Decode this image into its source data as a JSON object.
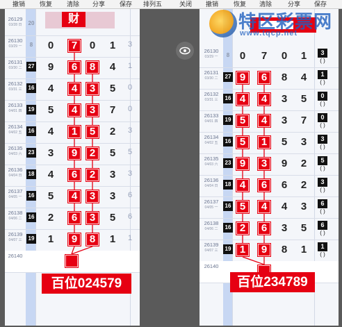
{
  "toolbar": {
    "undo": "撤销",
    "restore": "恢复",
    "clear": "清除",
    "share": "分享",
    "save": "保存",
    "p5": "排列五",
    "close": "关闭"
  },
  "left": {
    "rows": [
      {
        "issue": "26129",
        "date": "03/28 日",
        "sum": "20",
        "sumDark": false
      },
      {
        "issue": "26130",
        "date": "03/29 一",
        "sum": "8",
        "sumDark": false,
        "digits": [
          "0",
          "7",
          "0",
          "1"
        ],
        "hit": 1,
        "side": "3"
      },
      {
        "issue": "26131",
        "date": "03/30 二",
        "sum": "27",
        "sumDark": true,
        "digits": [
          "9",
          "6",
          "8",
          "4"
        ],
        "hit": 1,
        "hit2": 2,
        "side": "1"
      },
      {
        "issue": "26132",
        "date": "03/31 三",
        "sum": "16",
        "sumDark": true,
        "digits": [
          "4",
          "4",
          "3",
          "5"
        ],
        "hit": 1,
        "hit2": 2,
        "side": "0"
      },
      {
        "issue": "26133",
        "date": "04/01 四",
        "sum": "19",
        "sumDark": true,
        "digits": [
          "5",
          "4",
          "3",
          "7"
        ],
        "hit": 1,
        "hit2": 2,
        "side": "0"
      },
      {
        "issue": "26134",
        "date": "04/02 五",
        "sum": "16",
        "sumDark": true,
        "digits": [
          "4",
          "1",
          "5",
          "2"
        ],
        "hit": 1,
        "hit2": 2,
        "side": "3"
      },
      {
        "issue": "26135",
        "date": "04/03 六",
        "sum": "23",
        "sumDark": true,
        "digits": [
          "3",
          "9",
          "2",
          "5"
        ],
        "hit": 1,
        "hit2": 2,
        "side": "5"
      },
      {
        "issue": "26136",
        "date": "04/04 日",
        "sum": "18",
        "sumDark": true,
        "digits": [
          "4",
          "6",
          "2",
          "3"
        ],
        "hit": 1,
        "hit2": 2,
        "side": "3"
      },
      {
        "issue": "26137",
        "date": "04/05 一",
        "sum": "16",
        "sumDark": true,
        "digits": [
          "5",
          "4",
          "3",
          "3"
        ],
        "hit": 1,
        "hit2": 2,
        "side": "6"
      },
      {
        "issue": "26138",
        "date": "04/06 二",
        "sum": "16",
        "sumDark": true,
        "digits": [
          "2",
          "6",
          "3",
          "5"
        ],
        "hit": 1,
        "hit2": 2,
        "side": "6"
      },
      {
        "issue": "26139",
        "date": "04/07 三",
        "sum": "19",
        "sumDark": true,
        "digits": [
          "1",
          "9",
          "8",
          "1"
        ],
        "hit": 1,
        "hit2": 2,
        "side": "1"
      },
      {
        "issue": "26140",
        "date": "",
        "sum": "",
        "sumDark": false,
        "digits": [],
        "hitOnly": 1
      }
    ],
    "caption": "百位024579",
    "headerMask": "财"
  },
  "right": {
    "rows": [
      {
        "issue": "26130",
        "date": "03/29 一",
        "sum": "8",
        "sumDark": false,
        "digits": [
          "0",
          "7",
          "0",
          "1"
        ],
        "box": "3"
      },
      {
        "issue": "26131",
        "date": "03/30 二",
        "sum": "27",
        "sumDark": true,
        "digits": [
          "9",
          "6",
          "8",
          "4"
        ],
        "hit": 0,
        "hit2": 1,
        "box": "1"
      },
      {
        "issue": "26132",
        "date": "03/31 三",
        "sum": "16",
        "sumDark": true,
        "digits": [
          "4",
          "4",
          "3",
          "5"
        ],
        "hit": 0,
        "hit2": 1,
        "box": "0"
      },
      {
        "issue": "26133",
        "date": "04/01 四",
        "sum": "19",
        "sumDark": true,
        "digits": [
          "5",
          "4",
          "3",
          "7"
        ],
        "hit": 0,
        "hit2": 1,
        "box": "0"
      },
      {
        "issue": "26134",
        "date": "04/02 五",
        "sum": "16",
        "sumDark": true,
        "digits": [
          "5",
          "1",
          "5",
          "3"
        ],
        "hit": 0,
        "hit2": 1,
        "box": "3"
      },
      {
        "issue": "26135",
        "date": "04/03 六",
        "sum": "23",
        "sumDark": true,
        "digits": [
          "9",
          "3",
          "9",
          "2"
        ],
        "hit": 0,
        "hit2": 1,
        "box": "5"
      },
      {
        "issue": "26136",
        "date": "04/04 日",
        "sum": "18",
        "sumDark": true,
        "digits": [
          "4",
          "6",
          "6",
          "2"
        ],
        "hit": 0,
        "hit2": 1,
        "box": "3"
      },
      {
        "issue": "26137",
        "date": "04/05 一",
        "sum": "16",
        "sumDark": true,
        "digits": [
          "5",
          "4",
          "4",
          "3"
        ],
        "hit": 0,
        "hit2": 1,
        "box": "6"
      },
      {
        "issue": "26138",
        "date": "04/06 二",
        "sum": "16",
        "sumDark": true,
        "digits": [
          "2",
          "6",
          "3",
          "5"
        ],
        "hit": 0,
        "hit2": 1,
        "box": "6"
      },
      {
        "issue": "26139",
        "date": "04/07 三",
        "sum": "19",
        "sumDark": true,
        "digits": [
          "1",
          "9",
          "8",
          "1"
        ],
        "hit": 0,
        "hit2": 1,
        "box": "1"
      },
      {
        "issue": "26140",
        "date": "",
        "sum": "",
        "sumDark": false,
        "digits": [],
        "hitOnly": 1
      }
    ],
    "caption": "百位234789"
  },
  "watermark": {
    "title": "特区彩票网",
    "url": "www.tqcp.net"
  },
  "colors": {
    "red": "#e60012",
    "panel": "#f4f6fa",
    "blue": "#c7d7f3"
  }
}
